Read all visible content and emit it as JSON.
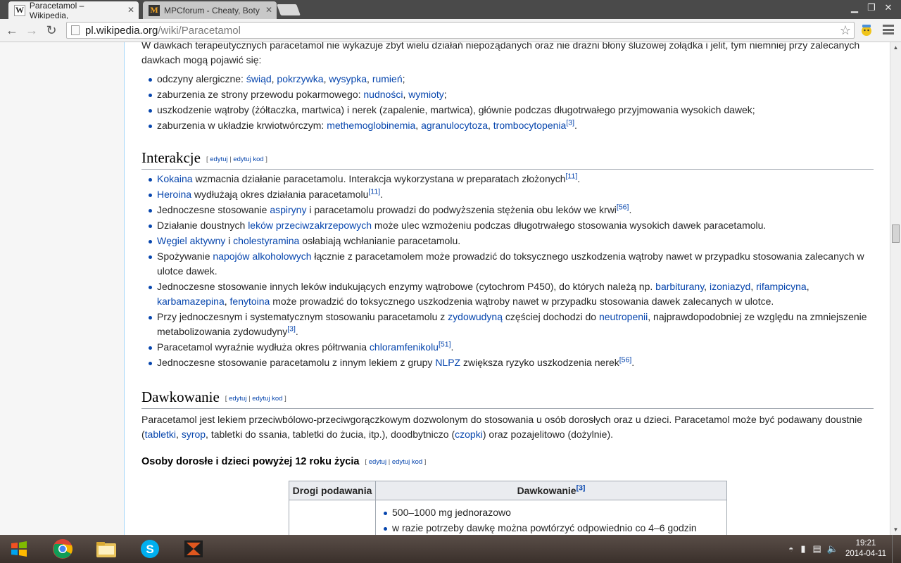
{
  "browser": {
    "tabs": [
      {
        "title": "Paracetamol – Wikipedia,",
        "favicon": "W",
        "active": true
      },
      {
        "title": "MPCforum - Cheaty, Boty",
        "favicon": "M",
        "active": false
      }
    ],
    "url_host": "pl.wikipedia.org",
    "url_path": "/wiki/Paracetamol",
    "icons": {
      "back": "back-arrow-icon",
      "forward": "forward-arrow-icon",
      "reload": "reload-icon",
      "bookmark": "star-icon",
      "menu": "hamburger-menu-icon"
    }
  },
  "article": {
    "intro_cut": "W dawkach terapeutycznych paracetamol nie wykazuje zbyt wielu działań niepożądanych oraz nie drażni błony śluzowej żołądka i jelit, tym niemniej przy zalecanych",
    "intro_cont": "dawkach mogą pojawić się:",
    "side_effects": {
      "allergic": {
        "text": "odczyny alergiczne: ",
        "links": [
          "świąd",
          "pokrzywka",
          "wysypka",
          "rumień"
        ],
        "end": ";"
      },
      "gi": {
        "text": "zaburzenia ze strony przewodu pokarmowego: ",
        "links": [
          "nudności",
          "wymioty"
        ],
        "end": ";"
      },
      "liver": {
        "text": "uszkodzenie wątroby (żółtaczka, martwica) i nerek (zapalenie, martwica), głównie podczas długotrwałego przyjmowania wysokich dawek;"
      },
      "blood": {
        "text": "zaburzenia w układzie krwiotwórczym: ",
        "links": [
          "methemoglobinemia",
          "agranulocytoza",
          "trombocytopenia"
        ],
        "ref": "[3]",
        "end": "."
      }
    },
    "sep": ", ",
    "edit_open": "[ ",
    "edit_label": "edytuj",
    "edit_sep": " | ",
    "edit_code_label": "edytuj kod",
    "edit_close": " ]",
    "interactions": {
      "heading": "Interakcje",
      "i1": {
        "link": "Kokaina",
        "text": " wzmacnia działanie paracetamolu. Interakcja wykorzystana w preparatach złożonych",
        "ref": "[11]",
        "end": "."
      },
      "i2": {
        "link": "Heroina",
        "text": " wydłużają okres działania paracetamolu",
        "ref": "[11]",
        "end": "."
      },
      "i3": {
        "pre": "Jednoczesne stosowanie ",
        "link": "aspiryny",
        "text": " i paracetamolu prowadzi do podwyższenia stężenia obu leków we krwi",
        "ref": "[56]",
        "end": "."
      },
      "i4": {
        "pre": "Działanie doustnych ",
        "link": "leków przeciwzakrzepowych",
        "text": " może ulec wzmożeniu podczas długotrwałego stosowania wysokich dawek paracetamolu."
      },
      "i5": {
        "link1": "Węgiel aktywny",
        "mid": " i ",
        "link2": "cholestyramina",
        "text": " osłabiają wchłanianie paracetamolu."
      },
      "i6": {
        "pre": "Spożywanie ",
        "link": "napojów alkoholowych",
        "text": " łącznie z paracetamolem może prowadzić do toksycznego uszkodzenia wątroby nawet w przypadku stosowania zalecanych w ulotce dawek."
      },
      "i7": {
        "pre": "Jednoczesne stosowanie innych leków indukujących enzymy wątrobowe (cytochrom P450), do których należą np. ",
        "links": [
          "barbiturany",
          "izoniazyd",
          "rifampicyna",
          "karbamazepina",
          "fenytoina"
        ],
        "text": " może prowadzić do toksycznego uszkodzenia wątroby nawet w przypadku stosowania dawek zalecanych w ulotce."
      },
      "i8": {
        "pre": "Przy jednoczesnym i systematycznym stosowaniu paracetamolu z ",
        "link1": "zydowudyną",
        "mid": " częściej dochodzi do ",
        "link2": "neutropenii",
        "text": ", najprawdopodobniej ze względu na zmniejszenie metabolizowania zydowudyny",
        "ref": "[3]",
        "end": "."
      },
      "i9": {
        "pre": "Paracetamol wyraźnie wydłuża okres półtrwania ",
        "link": "chloramfenikolu",
        "ref": "[51]",
        "end": "."
      },
      "i10": {
        "pre": "Jednoczesne stosowanie paracetamolu z innym lekiem z grupy ",
        "link": "NLPZ",
        "text": " zwiększa ryzyko uszkodzenia nerek",
        "ref": "[56]",
        "end": "."
      }
    },
    "dosage": {
      "heading": "Dawkowanie",
      "p1": "Paracetamol jest lekiem przeciwbólowo-przeciwgorączkowym dozwolonym do stosowania u osób dorosłych oraz u dzieci. Paracetamol może być podawany doustnie (",
      "l1": "tabletki",
      "l2": "syrop",
      "p2": ", tabletki do ssania, tabletki do żucia, itp.), doodbytniczo (",
      "l3": "czopki",
      "p3": ") oraz pozajelitowo (dożylnie).",
      "subheading": "Osoby dorosłe i dzieci powyżej 12 roku życia",
      "table": {
        "col1": "Drogi podawania",
        "col2": "Dawkowanie",
        "col2_ref": "[3]",
        "items": [
          "500–1000 mg jednorazowo",
          "w razie potrzeby dawkę można powtórzyć odpowiednio co 4–6 godzin"
        ]
      }
    }
  },
  "taskbar": {
    "apps": [
      "start-orb",
      "chrome-icon",
      "file-explorer-icon",
      "skype-icon",
      "app-icon"
    ],
    "time": "19:21",
    "date": "2014-04-11"
  }
}
